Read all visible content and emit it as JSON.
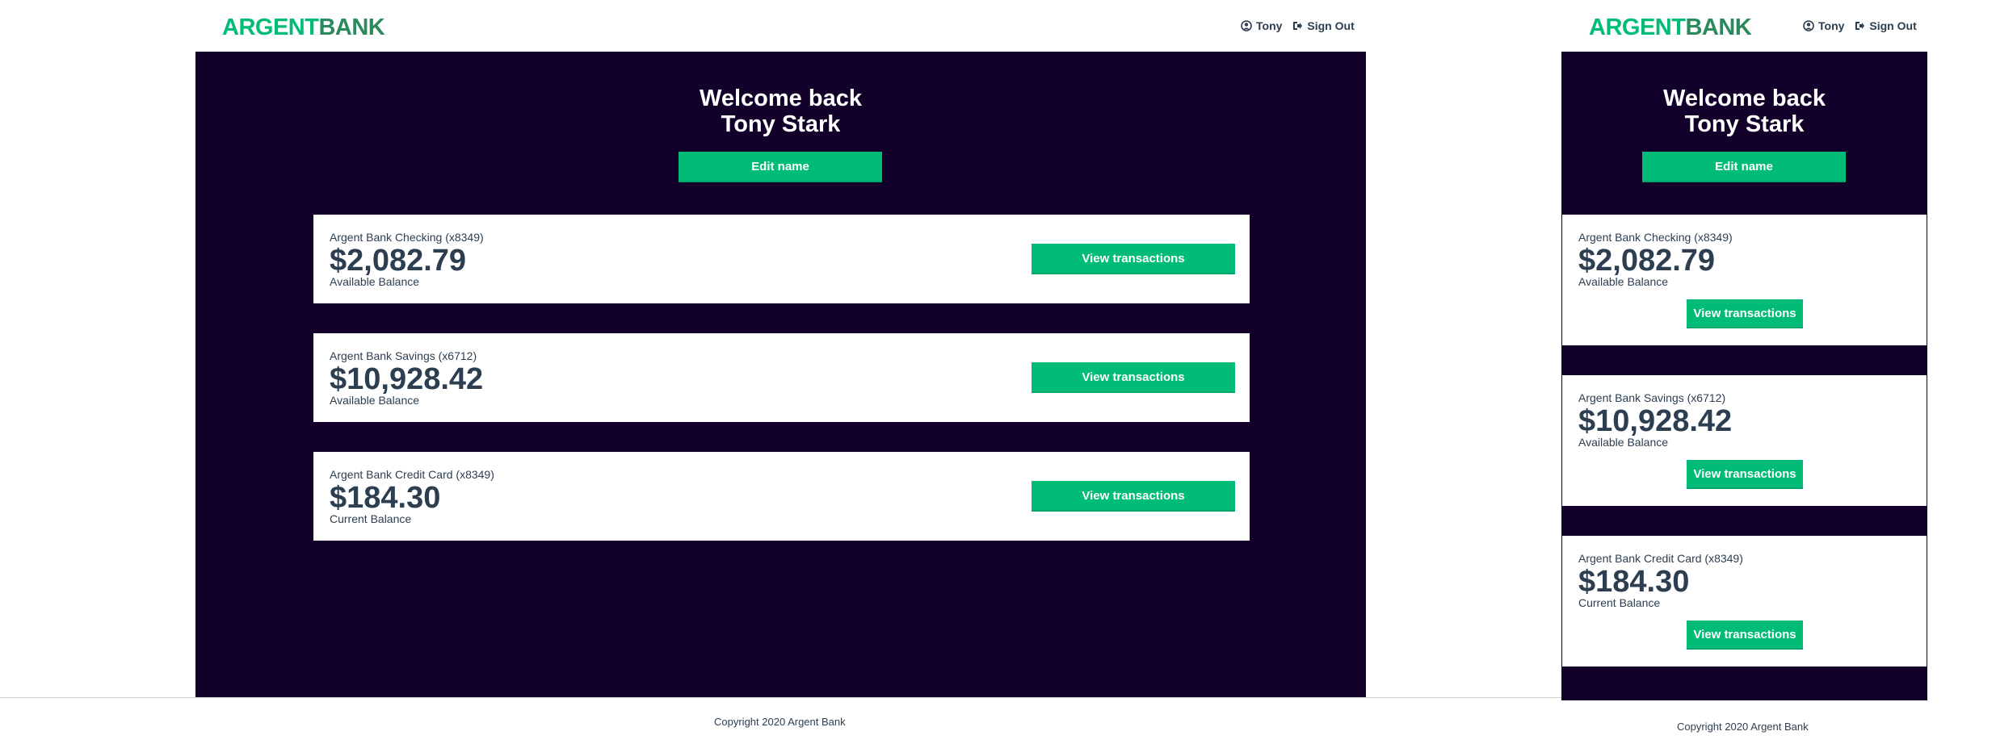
{
  "brand": {
    "part1": "ARGENT",
    "part2": "BANK"
  },
  "nav": {
    "user": "Tony",
    "signout": "Sign Out"
  },
  "welcome": {
    "line1": "Welcome back",
    "line2": "Tony Stark"
  },
  "edit_button": "Edit name",
  "accounts": [
    {
      "title": "Argent Bank Checking (x8349)",
      "amount": "$2,082.79",
      "desc": "Available Balance",
      "button": "View transactions"
    },
    {
      "title": "Argent Bank Savings (x6712)",
      "amount": "$10,928.42",
      "desc": "Available Balance",
      "button": "View transactions"
    },
    {
      "title": "Argent Bank Credit Card (x8349)",
      "amount": "$184.30",
      "desc": "Current Balance",
      "button": "View transactions"
    }
  ],
  "footer": {
    "copyright": "Copyright 2020 Argent Bank"
  },
  "colors": {
    "panel": "#12002b",
    "accent": "#00bc77",
    "text": "#2c3e50"
  }
}
